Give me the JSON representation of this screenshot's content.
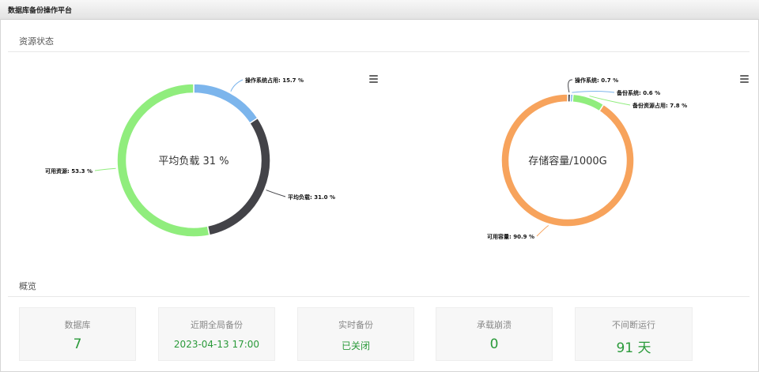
{
  "app": {
    "title": "数据库备份操作平台"
  },
  "sections": {
    "status_title": "资源状态",
    "overview_title": "概览"
  },
  "colors": {
    "blue": "#7cb5ec",
    "dark": "#434348",
    "green": "#90ed7d",
    "orange": "#f7a35c",
    "value_green": "#2a9a3a"
  },
  "chart_data": [
    {
      "type": "pie",
      "donut": true,
      "title": "平均负载 31 %",
      "slices": [
        {
          "label": "操作系统占用: 15.7 %",
          "value": 15.7,
          "color": "#7cb5ec"
        },
        {
          "label": "平均负载: 31.0 %",
          "value": 31.0,
          "color": "#434348"
        },
        {
          "label": "可用资源: 53.3 %",
          "value": 53.3,
          "color": "#90ed7d"
        }
      ]
    },
    {
      "type": "pie",
      "donut": true,
      "title": "存储容量/1000G",
      "slices": [
        {
          "label": "操作系统: 0.7 %",
          "value": 0.7,
          "color": "#434348"
        },
        {
          "label": "备份系统: 0.6 %",
          "value": 0.6,
          "color": "#7cb5ec"
        },
        {
          "label": "备份资源占用: 7.8 %",
          "value": 7.8,
          "color": "#90ed7d"
        },
        {
          "label": "可用容量: 90.9 %",
          "value": 90.9,
          "color": "#f7a35c"
        }
      ]
    }
  ],
  "overview": {
    "cards": [
      {
        "label": "数据库",
        "value": "7"
      },
      {
        "label": "近期全局备份",
        "value": "2023-04-13 17:00"
      },
      {
        "label": "实时备份",
        "value": "已关闭"
      },
      {
        "label": "承载崩溃",
        "value": "0"
      },
      {
        "label": "不间断运行",
        "value": "91 天"
      }
    ]
  }
}
